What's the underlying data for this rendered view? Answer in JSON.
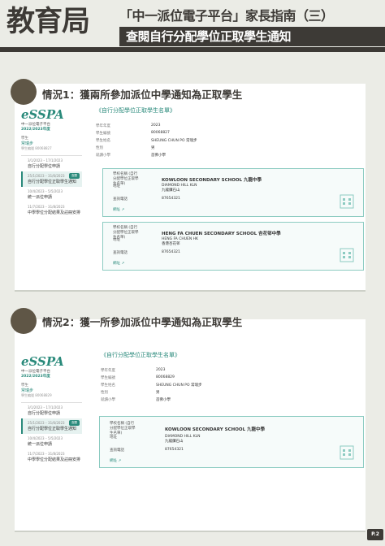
{
  "header": {
    "bureau": "教育局",
    "title": "「中一派位電子平台」家長指南（三）",
    "subtitle": "查閱自行分配學位正取學生通知"
  },
  "page_number": "P.2",
  "labels": {
    "sch_name": "學校名稱 (自行分配學位正取學生名單)",
    "address": "地址",
    "phone": "查詢電話",
    "website": "網址"
  },
  "situations": [
    {
      "heading": "情況1：獲兩所參加派位中學通知為正取學生",
      "sidebar": {
        "logo": "eSSPA",
        "sub1": "中一派位電子平台",
        "year": "2022/2023年度",
        "who1": "學生",
        "who2": "常瑞步",
        "who3": "學生編號 80068827",
        "items": [
          {
            "date": "3/1/2023 – 17/1/2023",
            "label": "自行分配學位申請"
          },
          {
            "date": "25/1/2023 – 31/6/2023",
            "label": "自行分配學位正取學生通知",
            "tag": "查閱"
          },
          {
            "date": "10/4/2023 – 5/5/2023",
            "label": "統一派位申請"
          },
          {
            "date": "11/7/2023 – 31/8/2023",
            "label": "中學學位分配結果及註冊安排"
          }
        ]
      },
      "main": {
        "title": "《自行分配學位正取學生名單》",
        "rows": [
          {
            "k": "學年年度",
            "v": "2023"
          },
          {
            "k": "學生編號",
            "v": "80068827"
          },
          {
            "k": "學生姓名",
            "v": "SHEUNG CHUN PO 常瑞步"
          },
          {
            "k": "性別",
            "v": "男"
          },
          {
            "k": "就讀小學",
            "v": "首佛小學"
          }
        ]
      },
      "schools": [
        {
          "name": "KOWLOON SECONDARY SCHOOL 九龍中學",
          "addr1": "DIAMOND HILL KLN",
          "addr2": "九龍鑽石山",
          "phone": "87654321"
        },
        {
          "name": "HENG FA CHUEN SECONDARY SCHOOL 杏花邨中學",
          "addr1": "HENG FA CHUEN HK",
          "addr2": "香港杏花邨",
          "phone": "87654321"
        }
      ]
    },
    {
      "heading": "情況2：獲一所參加派位中學通知為正取學生",
      "sidebar": {
        "logo": "eSSPA",
        "sub1": "中一派位電子平台",
        "year": "2022/2023年度",
        "who1": "學生",
        "who2": "常瑞步",
        "who3": "學生編號 80068829",
        "items": [
          {
            "date": "3/1/2023 – 17/1/2023",
            "label": "自行分配學位申請"
          },
          {
            "date": "25/1/2023 – 31/6/2023",
            "label": "自行分配學位正取學生通知",
            "tag": "查閱"
          },
          {
            "date": "10/4/2023 – 5/5/2023",
            "label": "統一派位申請"
          },
          {
            "date": "11/7/2023 – 31/8/2023",
            "label": "中學學位分配結果及註冊安排"
          }
        ]
      },
      "main": {
        "title": "《自行分配學位正取學生名單》",
        "rows": [
          {
            "k": "學年年度",
            "v": "2023"
          },
          {
            "k": "學生編號",
            "v": "80068829"
          },
          {
            "k": "學生姓名",
            "v": "SHEUNG CHUN PO 常瑞步"
          },
          {
            "k": "性別",
            "v": "男"
          },
          {
            "k": "就讀小學",
            "v": "首佛小學"
          }
        ]
      },
      "schools": [
        {
          "name": "KOWLOON SECONDARY SCHOOL 九龍中學",
          "addr1": "DIAMOND HILL KLN",
          "addr2": "九龍鑽石山",
          "phone": "87654321"
        }
      ]
    }
  ]
}
